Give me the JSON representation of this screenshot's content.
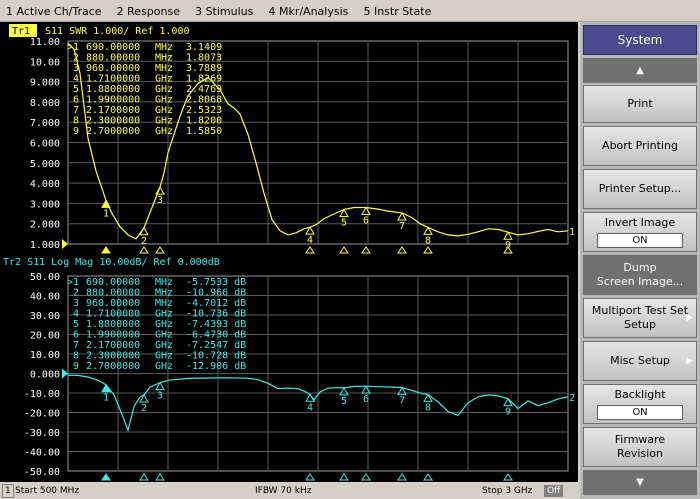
{
  "menu": [
    "1 Active Ch/Trace",
    "2 Response",
    "3 Stimulus",
    "4 Mkr/Analysis",
    "5 Instr State"
  ],
  "tr1": {
    "badge": "Tr1",
    "header": "S11  SWR 1.000/ Ref 1.000",
    "ticks": [
      "11.00",
      "10.00",
      "9.000",
      "8.000",
      "7.000",
      "6.000",
      "5.000",
      "4.000",
      "3.000",
      "2.000",
      "1.000"
    ],
    "color": "#ffff40",
    "markers": [
      {
        "id": ">1",
        "freq": "690.00000",
        "unit": "MHz",
        "value": "3.1409"
      },
      {
        "id": "2",
        "freq": "880.00000",
        "unit": "MHz",
        "value": "1.8073"
      },
      {
        "id": "3",
        "freq": "960.00000",
        "unit": "MHz",
        "value": "3.7889"
      },
      {
        "id": "4",
        "freq": "1.7100000",
        "unit": "GHz",
        "value": "1.8269"
      },
      {
        "id": "5",
        "freq": "1.8800000",
        "unit": "GHz",
        "value": "2.4769"
      },
      {
        "id": "6",
        "freq": "1.9900000",
        "unit": "GHz",
        "value": "2.8068"
      },
      {
        "id": "7",
        "freq": "2.1700000",
        "unit": "GHz",
        "value": "2.5323"
      },
      {
        "id": "8",
        "freq": "2.3000000",
        "unit": "GHz",
        "value": "1.8200"
      },
      {
        "id": "9",
        "freq": "2.7000000",
        "unit": "GHz",
        "value": "1.5850"
      }
    ],
    "trace_label": "1"
  },
  "tr2": {
    "header": "Tr2  S11  Log Mag 10.00dB/ Ref 0.000dB",
    "ticks": [
      "50.00",
      "40.00",
      "30.00",
      "20.00",
      "10.00",
      "0.000",
      "-10.00",
      "-20.00",
      "-30.00",
      "-40.00",
      "-50.00"
    ],
    "color": "#40e8e8",
    "markers": [
      {
        "id": ">1",
        "freq": "690.00000",
        "unit": "MHz",
        "value": "-5.7533 dB"
      },
      {
        "id": "2",
        "freq": "880.00000",
        "unit": "MHz",
        "value": "-10.966 dB"
      },
      {
        "id": "3",
        "freq": "960.00000",
        "unit": "MHz",
        "value": "-4.7012 dB"
      },
      {
        "id": "4",
        "freq": "1.7100000",
        "unit": "GHz",
        "value": "-10.736 dB"
      },
      {
        "id": "5",
        "freq": "1.8800000",
        "unit": "GHz",
        "value": "-7.4393 dB"
      },
      {
        "id": "6",
        "freq": "1.9900000",
        "unit": "GHz",
        "value": "-6.4730 dB"
      },
      {
        "id": "7",
        "freq": "2.1700000",
        "unit": "GHz",
        "value": "-7.2547 dB"
      },
      {
        "id": "8",
        "freq": "2.3000000",
        "unit": "GHz",
        "value": "-10.728 dB"
      },
      {
        "id": "9",
        "freq": "2.7000000",
        "unit": "GHz",
        "value": "-12.906 dB"
      }
    ],
    "trace_label": "2"
  },
  "chart_data": [
    {
      "type": "line",
      "title": "S11  SWR 1.000/ Ref 1.000",
      "x_unit": "MHz",
      "xlim": [
        500,
        3000
      ],
      "ylim": [
        1,
        11
      ],
      "series": [
        {
          "name": "Tr1",
          "x": [
            500,
            530,
            560,
            600,
            640,
            690,
            720,
            760,
            800,
            840,
            880,
            920,
            960,
            980,
            1000,
            1030,
            1060,
            1100,
            1150,
            1200,
            1260,
            1300,
            1330,
            1360,
            1400,
            1440,
            1480,
            1520,
            1560,
            1600,
            1640,
            1680,
            1710,
            1740,
            1780,
            1830,
            1880,
            1930,
            1990,
            2050,
            2100,
            2170,
            2220,
            2260,
            2300,
            2350,
            2400,
            2450,
            2500,
            2550,
            2600,
            2650,
            2700,
            2750,
            2800,
            2850,
            2900,
            2950,
            3000
          ],
          "y": [
            10.9,
            10.6,
            9.4,
            6.2,
            4.6,
            3.15,
            2.5,
            1.85,
            1.45,
            1.25,
            1.8,
            2.8,
            3.8,
            4.5,
            5.5,
            6.4,
            7.3,
            8.3,
            8.9,
            9.2,
            8.6,
            7.9,
            7.7,
            7.4,
            6.4,
            5.0,
            3.5,
            2.2,
            1.65,
            1.45,
            1.55,
            1.75,
            1.83,
            1.95,
            2.25,
            2.48,
            2.7,
            2.8,
            2.8,
            2.72,
            2.62,
            2.53,
            2.3,
            2.0,
            1.82,
            1.6,
            1.45,
            1.4,
            1.48,
            1.6,
            1.75,
            1.72,
            1.58,
            1.45,
            1.5,
            1.62,
            1.72,
            1.6,
            1.65
          ]
        }
      ]
    },
    {
      "type": "line",
      "title": "S11  Log Mag 10.00dB/ Ref 0.000dB",
      "x_unit": "MHz",
      "xlim": [
        500,
        3000
      ],
      "ylim": [
        -50,
        50
      ],
      "series": [
        {
          "name": "Tr2",
          "x": [
            500,
            550,
            600,
            650,
            690,
            730,
            770,
            800,
            830,
            860,
            880,
            910,
            960,
            1000,
            1100,
            1200,
            1300,
            1400,
            1450,
            1500,
            1550,
            1600,
            1650,
            1690,
            1710,
            1730,
            1760,
            1800,
            1850,
            1880,
            1930,
            1990,
            2060,
            2120,
            2170,
            2230,
            2270,
            2300,
            2350,
            2400,
            2450,
            2500,
            2550,
            2600,
            2650,
            2700,
            2750,
            2800,
            2850,
            2900,
            2950,
            3000
          ],
          "y": [
            -0.8,
            -1.0,
            -1.8,
            -3.5,
            -5.75,
            -11,
            -21,
            -29,
            -17,
            -12,
            -11,
            -7,
            -4.7,
            -3.5,
            -2.5,
            -2.3,
            -2.2,
            -2.4,
            -3.2,
            -5.0,
            -7.8,
            -7.5,
            -7.8,
            -9.5,
            -10.7,
            -13.5,
            -9.5,
            -7.5,
            -7.3,
            -7.4,
            -6.6,
            -6.5,
            -6.8,
            -7.0,
            -7.25,
            -9.0,
            -10.3,
            -10.7,
            -14.5,
            -19.5,
            -21.5,
            -15,
            -12,
            -11,
            -11.5,
            -12.9,
            -18,
            -14,
            -16.5,
            -15,
            -13,
            -12
          ]
        }
      ]
    }
  ],
  "status": {
    "channel": "1",
    "start": "Start 500 MHz",
    "ifbw": "IFBW 70 kHz",
    "stop": "Stop 3 GHz",
    "off": "Off"
  },
  "softkeys": {
    "title": "System",
    "print": "Print",
    "abort_printing": "Abort Printing",
    "printer_setup": "Printer Setup...",
    "invert_image": "Invert Image",
    "invert_image_value": "ON",
    "dump_line1": "Dump",
    "dump_line2": "Screen Image...",
    "multiport_line1": "Multiport Test Set",
    "multiport_line2": "Setup",
    "misc_setup": "Misc Setup",
    "backlight": "Backlight",
    "backlight_value": "ON",
    "firmware_line1": "Firmware",
    "firmware_line2": "Revision"
  }
}
